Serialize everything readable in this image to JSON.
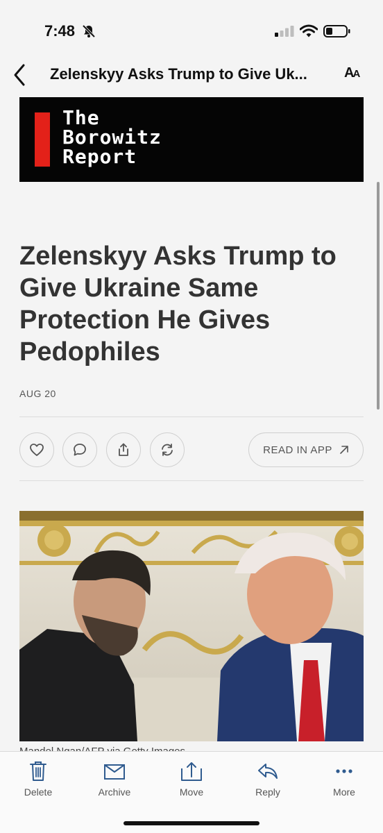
{
  "status_bar": {
    "time": "7:48"
  },
  "nav": {
    "title": "Zelenskyy Asks Trump to Give Uk..."
  },
  "banner": {
    "logo_line1": "The",
    "logo_line2": "Borowitz",
    "logo_line3": "Report",
    "accent_color": "#e32119"
  },
  "article": {
    "headline": "Zelenskyy Asks Trump to Give Ukraine Same Protection He Gives Pedophiles",
    "date": "AUG 20",
    "read_in_app_label": "READ IN APP",
    "caption": "Mandel Ngan/AFP via Getty Images"
  },
  "toolbar": {
    "items": [
      {
        "label": "Delete",
        "icon": "trash-icon"
      },
      {
        "label": "Archive",
        "icon": "archive-icon"
      },
      {
        "label": "Move",
        "icon": "move-icon"
      },
      {
        "label": "Reply",
        "icon": "reply-icon"
      },
      {
        "label": "More",
        "icon": "more-icon"
      }
    ]
  }
}
